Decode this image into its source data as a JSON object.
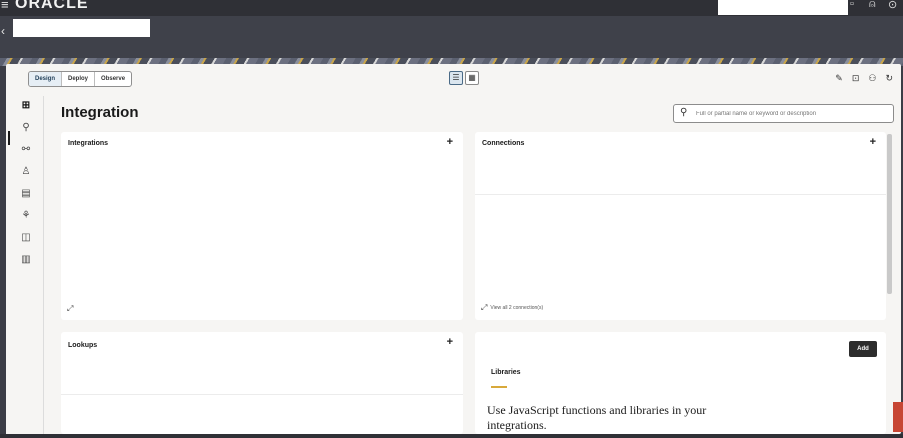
{
  "topbar": {
    "menu_icon": "hamburger-icon",
    "brand": "ORACLE",
    "icons": [
      "help-icon",
      "notification-icon",
      "user-icon"
    ]
  },
  "subbar": {
    "back_icon": "chevron-left-icon"
  },
  "modes": {
    "design": "Design",
    "deploy": "Deploy",
    "observe": "Observe",
    "active": "Design"
  },
  "view_toggle": [
    "list-view-icon",
    "grid-view-icon"
  ],
  "top_icons": [
    "edit-icon",
    "export-icon",
    "users-icon",
    "refresh-icon"
  ],
  "rail": {
    "items": [
      "home-grid-icon",
      "integration-icon",
      "connections-icon",
      "person-icon",
      "table-icon",
      "agent-icon",
      "library-icon",
      "report-icon"
    ]
  },
  "page": {
    "title": "Integration",
    "search_placeholder": "Full or partial name or keyword or description"
  },
  "cards": {
    "integrations": {
      "title": "Integrations",
      "plus": "+",
      "expand_icon": "expand-icon"
    },
    "connections": {
      "title": "Connections",
      "plus": "+",
      "view_all": "View all 2 connection(s)"
    },
    "lookups": {
      "title": "Lookups",
      "plus": "+"
    },
    "libraries": {
      "add": "Add",
      "title": "Libraries",
      "text": "Use JavaScript functions and libraries in your integrations."
    }
  },
  "colors": {
    "accent_underline": "#d8a93b",
    "brand_red": "#c74634",
    "header_bg": "#2f3036"
  }
}
